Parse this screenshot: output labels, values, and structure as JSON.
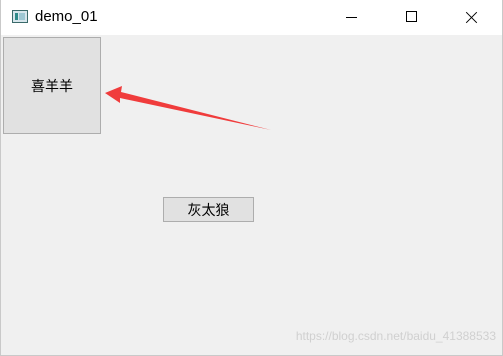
{
  "window": {
    "title": "demo_01",
    "icon": "app-window-icon",
    "controls": {
      "minimize_icon": "minimize-icon",
      "maximize_icon": "maximize-icon",
      "close_icon": "close-icon"
    }
  },
  "buttons": {
    "xiyangyang": "喜羊羊",
    "huitailang": "灰太狼"
  },
  "annotation": {
    "arrow_icon": "red-arrow-icon",
    "arrow_color": "#f03c3c"
  },
  "watermark": "https://blog.csdn.net/baidu_41388533"
}
